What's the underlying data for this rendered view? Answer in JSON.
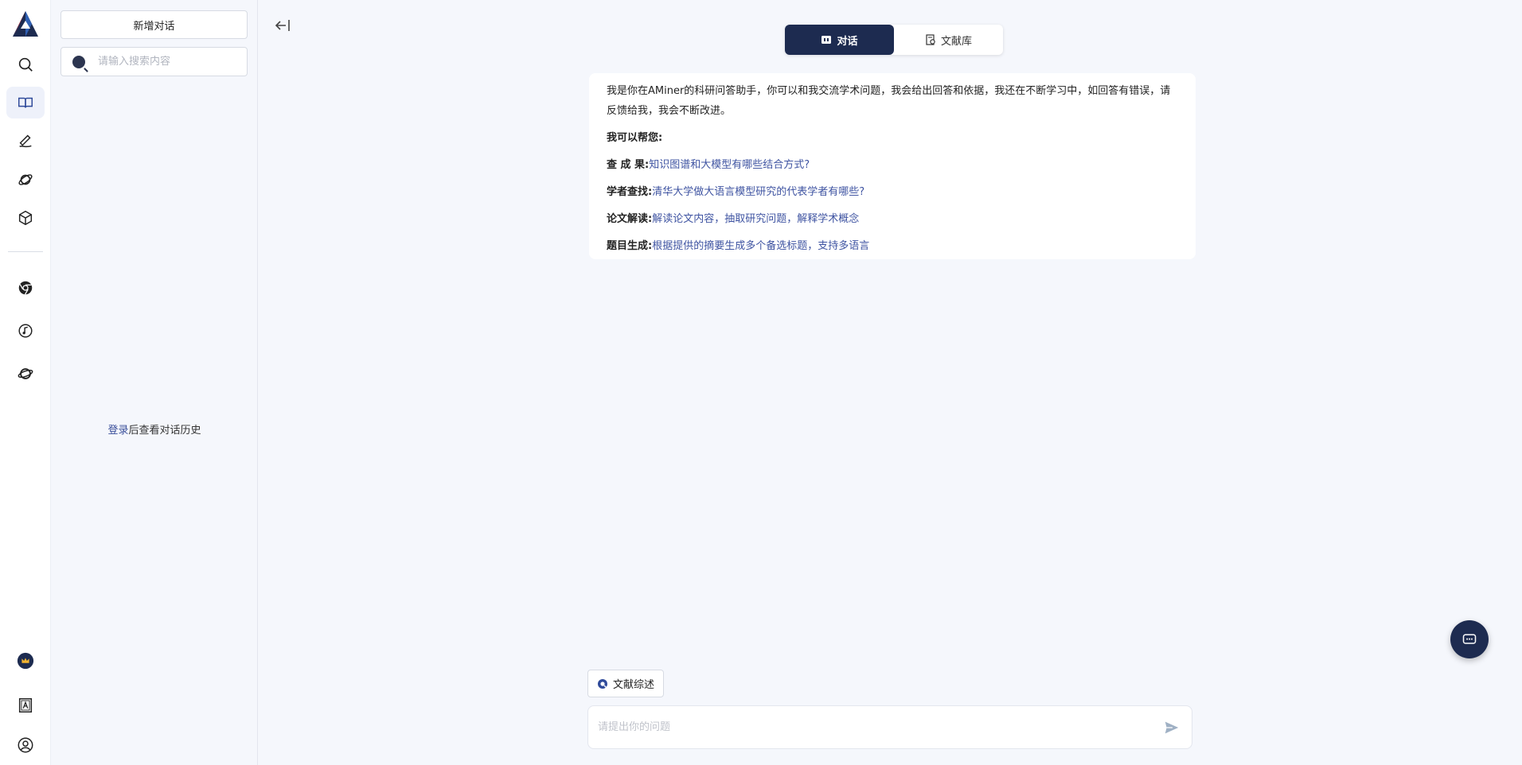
{
  "sidebar": {
    "new_chat_label": "新增对话",
    "search_placeholder": "请输入搜索内容",
    "login_link": "登录",
    "login_hint_rest": "后查看对话历史"
  },
  "rail": {
    "icons": [
      "aminer-logo",
      "search-icon",
      "book-icon",
      "pen-icon",
      "planet-icon",
      "cube-icon",
      "chrome-icon",
      "music-note-icon",
      "orbit-icon",
      "crown-badge-icon",
      "document-a-icon",
      "user-icon"
    ],
    "active": "book-icon"
  },
  "switcher": {
    "tabs": [
      {
        "label": "对话",
        "active": true
      },
      {
        "label": "文献库",
        "active": false
      }
    ]
  },
  "welcome": {
    "intro": "我是你在AMiner的科研问答助手，你可以和我交流学术问题，我会给出回答和依据，我还在不断学习中，如回答有错误，请反馈给我，我会不断改进。",
    "help_title": "我可以帮您:",
    "items": [
      {
        "key": "查 成 果:",
        "value": "知识图谱和大模型有哪些结合方式?"
      },
      {
        "key": "学者查找:",
        "value": "清华大学做大语言模型研究的代表学者有哪些?"
      },
      {
        "key": "论文解读:",
        "value": "解读论文内容，抽取研究问题，解释学术概念"
      },
      {
        "key": "题目生成:",
        "value": "根据提供的摘要生成多个备选标题，支持多语言"
      }
    ]
  },
  "composer": {
    "literature_review_label": "文献综述",
    "placeholder": "请提出你的问题"
  },
  "colors": {
    "brand_navy": "#1d2b50",
    "link_blue": "#3f54a2",
    "background": "#f5f7fc"
  }
}
